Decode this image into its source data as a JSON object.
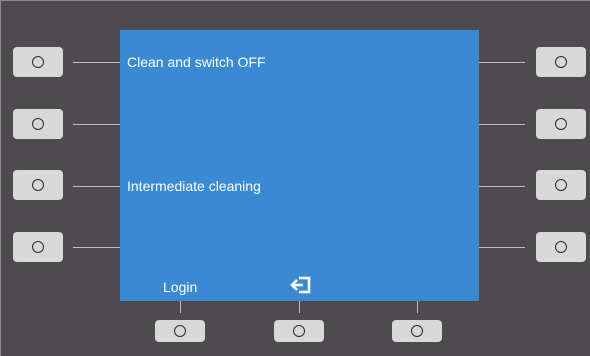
{
  "screen": {
    "left_labels": [
      "Clean and switch OFF",
      "",
      "Intermediate cleaning",
      ""
    ],
    "right_labels": [
      "",
      "",
      "",
      ""
    ],
    "bottom_labels": [
      "Login",
      "",
      ""
    ],
    "bottom_icons": [
      "",
      "logout-icon",
      ""
    ]
  },
  "colors": {
    "background": "#4d4b4e",
    "screen": "#3a8ad3",
    "button": "#d8d8d8",
    "text": "#ffffff"
  }
}
